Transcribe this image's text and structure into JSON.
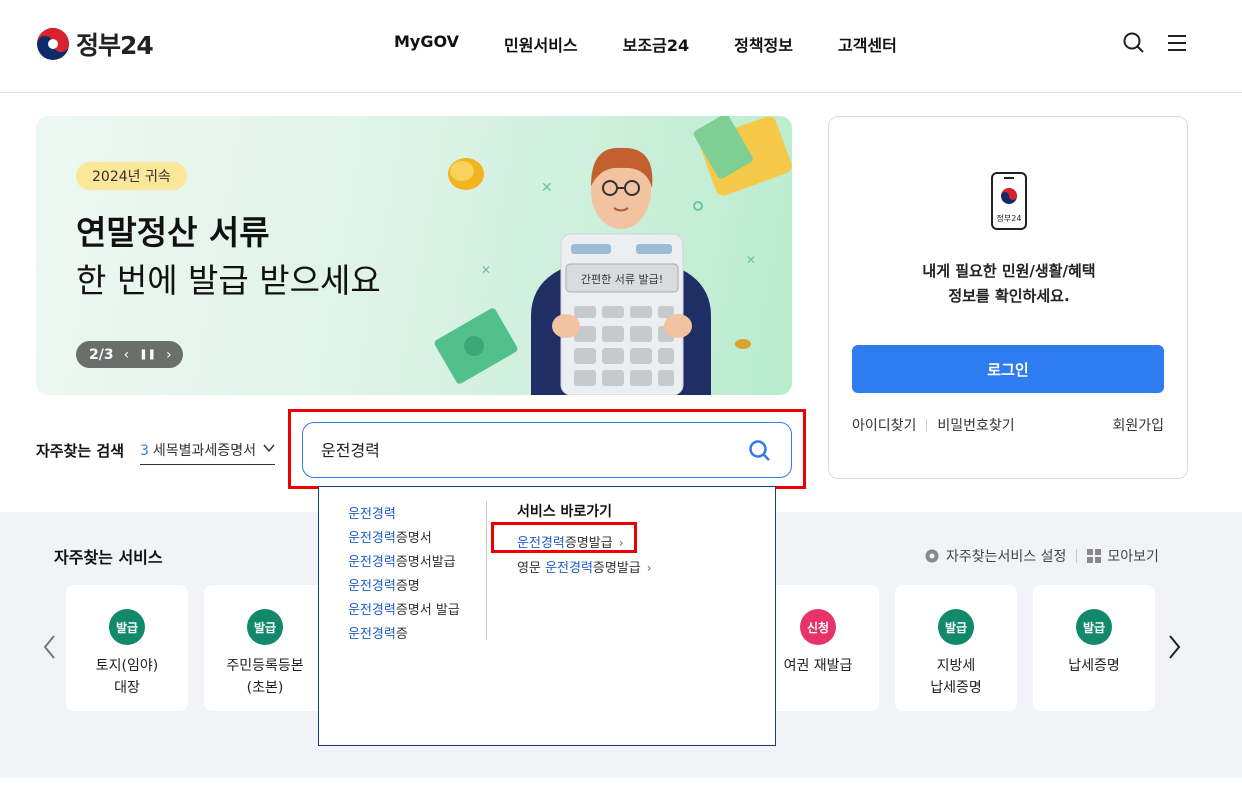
{
  "header": {
    "logo_text": "정부24",
    "nav": [
      "MyGOV",
      "민원서비스",
      "보조금24",
      "정책정보",
      "고객센터"
    ]
  },
  "banner": {
    "tag": "2024년 귀속",
    "title": "연말정산 서류",
    "subtitle": "한 번에 발급 받으세요",
    "pager": "2/3",
    "calc_label": "간편한 서류 발급!"
  },
  "login": {
    "phone_label": "정부24",
    "line1": "내게 필요한 민원/생활/혜택",
    "line2": "정보를 확인하세요.",
    "button": "로그인",
    "find_id": "아이디찾기",
    "find_pw": "비밀번호찾기",
    "signup": "회원가입"
  },
  "search": {
    "freq_label": "자주찾는 검색",
    "freq_num": "3",
    "freq_term": "세목별과세증명서",
    "query": "운전경력"
  },
  "autocomplete": {
    "suggestions": [
      {
        "hl": "운전경력",
        "rest": ""
      },
      {
        "hl": "운전경력",
        "rest": "증명서"
      },
      {
        "hl": "운전경력",
        "rest": "증명서발급"
      },
      {
        "hl": "운전경력",
        "rest": "증명"
      },
      {
        "hl": "운전경력",
        "rest": "증명서 발급"
      },
      {
        "hl": "운전경력",
        "rest": "증"
      }
    ],
    "shortcut_title": "서비스 바로가기",
    "shortcuts": [
      {
        "pre": "",
        "hl": "운전경력",
        "rest": "증명발급"
      },
      {
        "pre": "영문 ",
        "hl": "운전경력",
        "rest": "증명발급"
      }
    ]
  },
  "services": {
    "title": "자주찾는 서비스",
    "settings": "자주찾는서비스 설정",
    "view_all": "모아보기",
    "cards": [
      {
        "badge": "발급",
        "line1": "토지(임야)",
        "line2": "대장",
        "color": "#11896a"
      },
      {
        "badge": "발급",
        "line1": "주민등록등본",
        "line2": "(초본)",
        "color": "#11896a"
      },
      {
        "badge": "신청",
        "line1": "여권 재발급",
        "line2": "",
        "color": "#e8336a"
      },
      {
        "badge": "발급",
        "line1": "지방세",
        "line2": "납세증명",
        "color": "#11896a"
      },
      {
        "badge": "발급",
        "line1": "납세증명",
        "line2": "",
        "color": "#11896a"
      }
    ]
  }
}
